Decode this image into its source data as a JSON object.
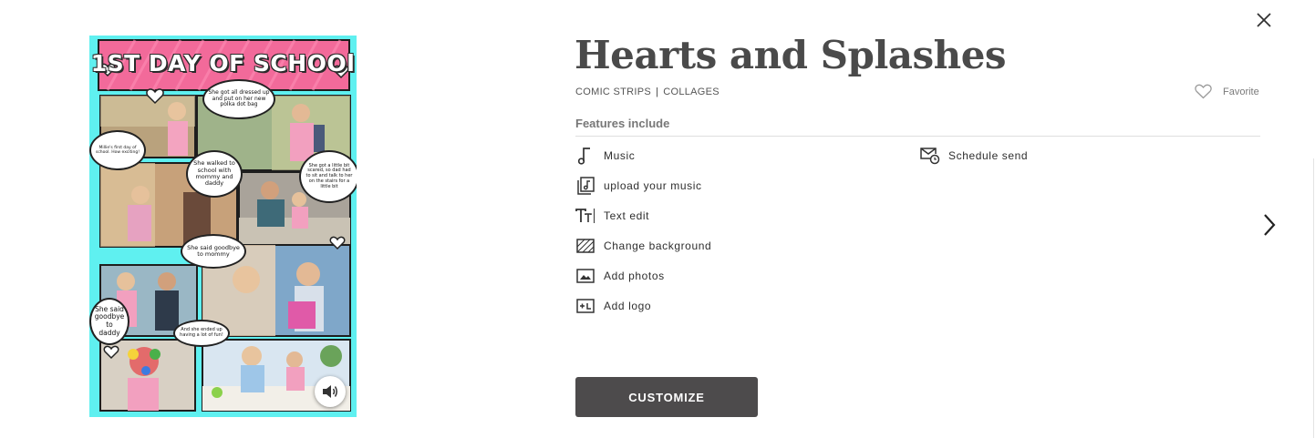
{
  "product": {
    "title": "Hearts and Splashes",
    "categories": [
      "COMIC STRIPS",
      "COLLAGES"
    ],
    "separator": "|",
    "favorite_label": "Favorite"
  },
  "card_preview": {
    "headline": "1ST DAY OF SCHOOl",
    "bubbles": [
      "She got all dressed up and put on her new polka dot bag",
      "Millie's first day of school. How exciting!",
      "She walked to school with mommy and daddy",
      "She got a little bit scared, so dad had to sit and talk to her on the stairs for a little bit",
      "She said goodbye to mommy",
      "She said goodbye to daddy",
      "And she ended up having a lot of fun!"
    ],
    "colors": {
      "background": "#5ff0f0",
      "header": "#f26a9a"
    },
    "sound_icon": "speaker-icon"
  },
  "features": {
    "heading": "Features include",
    "items": [
      {
        "icon": "music-note-icon",
        "label": "Music"
      },
      {
        "icon": "upload-music-icon",
        "label": "upload your music"
      },
      {
        "icon": "text-edit-icon",
        "label": "Text edit"
      },
      {
        "icon": "background-icon",
        "label": "Change background"
      },
      {
        "icon": "photo-icon",
        "label": "Add photos"
      },
      {
        "icon": "add-logo-icon",
        "label": "Add logo"
      },
      {
        "icon": "schedule-send-icon",
        "label": "Schedule send"
      }
    ]
  },
  "actions": {
    "customize_label": "CUSTOMIZE"
  },
  "colors": {
    "button": "#4d4b4c",
    "title": "#4a4a4a",
    "accent_cyan": "#5ff0f0"
  }
}
